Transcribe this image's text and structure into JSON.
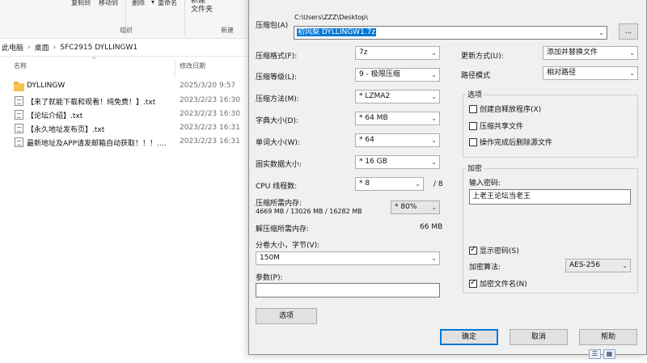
{
  "explorer": {
    "ribbon": {
      "copy_to": "复制到",
      "move_to": "移动到",
      "delete": "删除",
      "rename": "重命名",
      "new_folder": "新建\n文件夹",
      "group_organize": "组织",
      "group_new": "新建"
    },
    "breadcrumb": [
      "此电脑",
      "桌面",
      "SFC2915 DYLLINGW1"
    ],
    "columns": {
      "name": "名称",
      "modified": "修改日期"
    },
    "files": [
      {
        "name": "DYLLINGW",
        "date": "2025/3/20 9:57",
        "type": "folder"
      },
      {
        "name": "【来了就能下载和观看！纯免费！】.txt",
        "date": "2023/2/23 16:30",
        "type": "txt"
      },
      {
        "name": "【论坛介绍】.txt",
        "date": "2023/2/23 16:30",
        "type": "txt"
      },
      {
        "name": "【永久地址发布页】.txt",
        "date": "2023/2/23 16:31",
        "type": "txt"
      },
      {
        "name": "最新地址及APP请发邮箱自动获取！！！....",
        "date": "2023/2/23 16:31",
        "type": "txt"
      }
    ]
  },
  "dialog": {
    "archive_label": "压缩包(A)",
    "archive_path": "C:\\Users\\ZZZ\\Desktop\\",
    "archive_name": "初风梨 DYLLINGW1.7z",
    "browse_label": "...",
    "left": {
      "format_label": "压缩格式(F):",
      "format_value": "7z",
      "level_label": "压缩等级(L):",
      "level_value": "9 - 极限压缩",
      "method_label": "压缩方法(M):",
      "method_value": "* LZMA2",
      "dict_label": "字典大小(D):",
      "dict_value": "* 64 MB",
      "word_label": "单词大小(W):",
      "word_value": "* 64",
      "solid_label": "固实数据大小:",
      "solid_value": "* 16 GB",
      "threads_label": "CPU 线程数:",
      "threads_value": "* 8",
      "threads_max": "/ 8",
      "mem_comp_label": "压缩所需内存:",
      "mem_comp_value": "4669 MB / 13026 MB / 16282 MB",
      "mem_percent": "* 80%",
      "mem_decomp_label": "解压缩所需内存:",
      "mem_decomp_value": "66 MB",
      "volume_label": "分卷大小，字节(V):",
      "volume_value": "150M",
      "params_label": "参数(P):",
      "params_value": "",
      "options_button": "选项"
    },
    "right": {
      "update_label": "更新方式(U):",
      "update_value": "添加并替换文件",
      "path_label": "路径模式",
      "path_value": "相对路径",
      "options_title": "选项",
      "opt_sfx": "创建自释放程序(X)",
      "opt_shared": "压缩共享文件",
      "opt_delete": "操作完成后删除源文件",
      "encrypt_title": "加密",
      "password_label": "输入密码:",
      "password_value": "上老王论坛当老王",
      "show_password": "显示密码(S)",
      "enc_method_label": "加密算法:",
      "enc_method_value": "AES-256",
      "encrypt_names": "加密文件名(N)"
    },
    "buttons": {
      "ok": "确定",
      "cancel": "取消",
      "help": "帮助"
    }
  }
}
